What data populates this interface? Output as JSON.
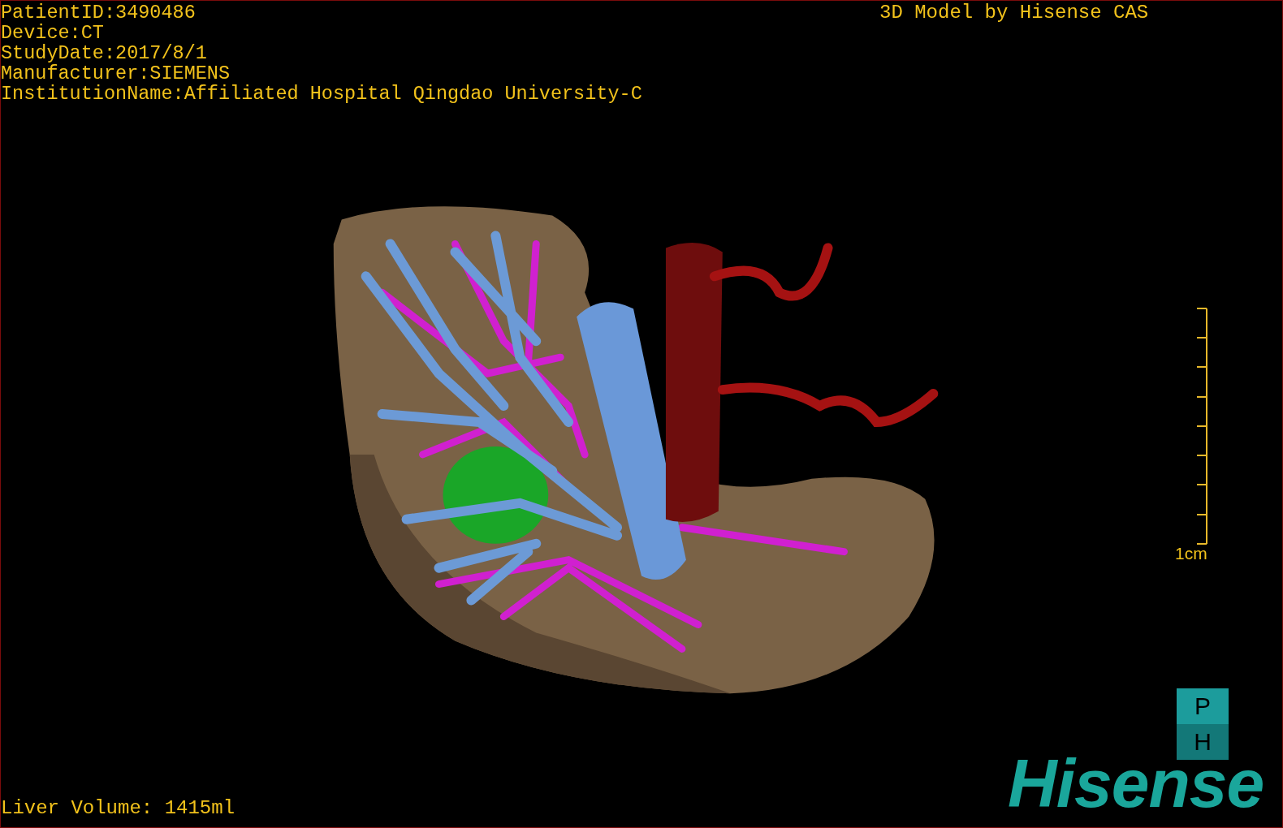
{
  "patient_info": [
    "PatientID:3490486",
    "Device:CT",
    "StudyDate:2017/8/1",
    "Manufacturer:SIEMENS",
    "InstitutionName:Affiliated Hospital Qingdao University-C"
  ],
  "model_credit": "3D Model by Hisense CAS",
  "scale_bar": {
    "label": "1cm"
  },
  "orientation_cube": {
    "top": "P",
    "bottom": "H"
  },
  "liver_volume": "Liver Volume: 1415ml",
  "logo": "Hisense"
}
